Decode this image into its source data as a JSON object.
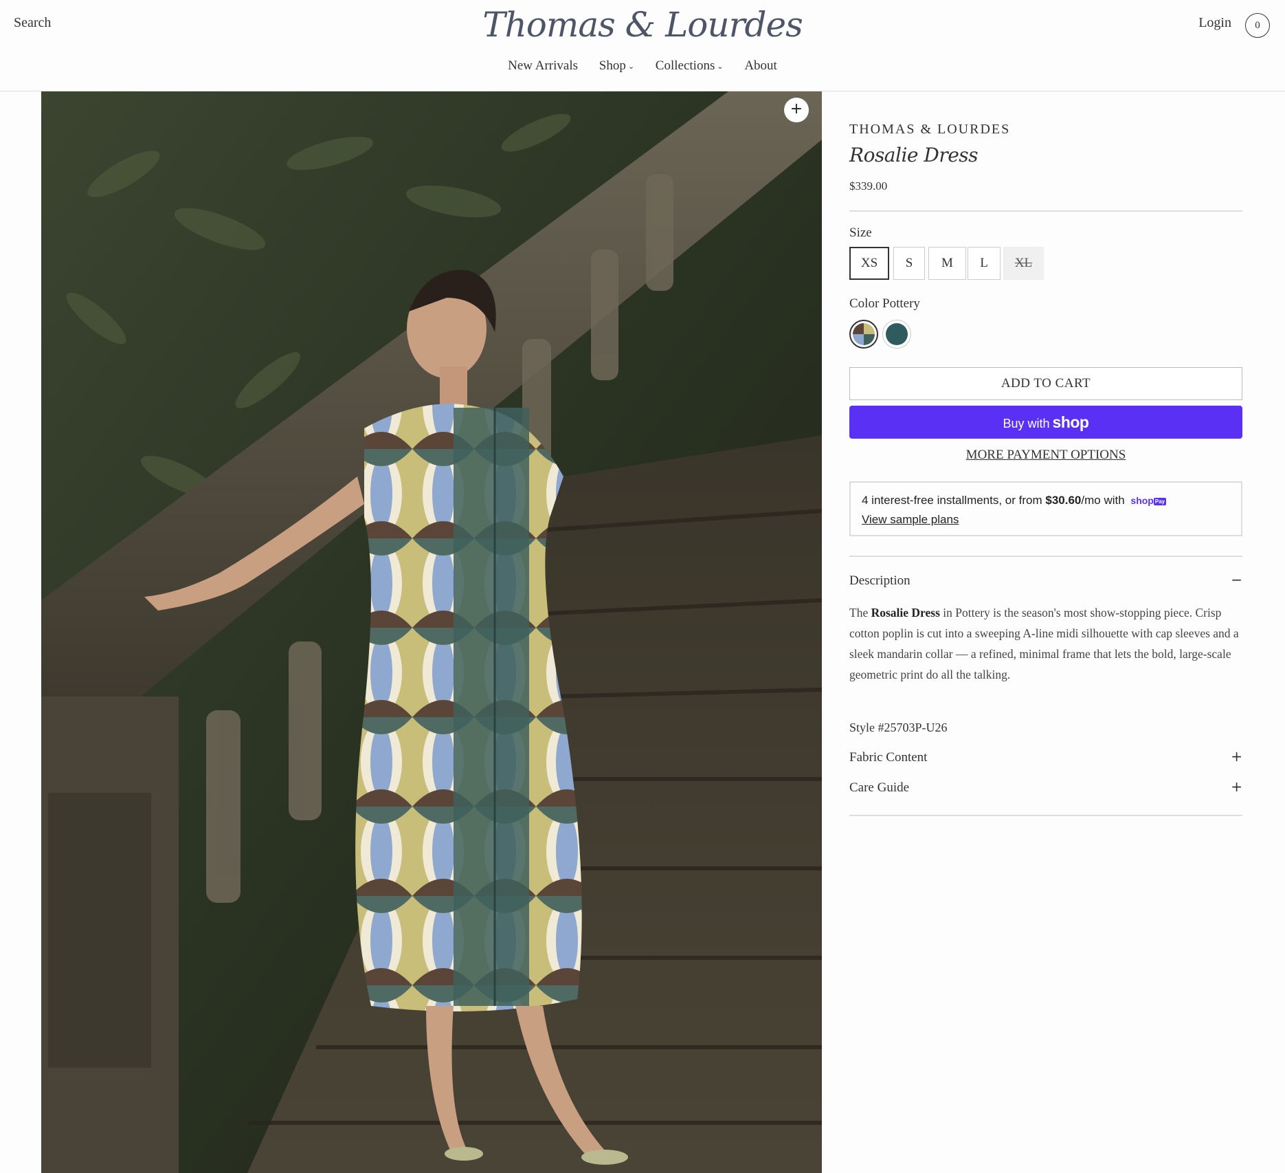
{
  "header": {
    "search_label": "Search",
    "logo_text": "Thomas & Lourdes",
    "login_label": "Login",
    "cart_count": "0",
    "nav": [
      {
        "label": "New Arrivals",
        "has_dropdown": false
      },
      {
        "label": "Shop",
        "has_dropdown": true
      },
      {
        "label": "Collections",
        "has_dropdown": true
      },
      {
        "label": "About",
        "has_dropdown": false
      }
    ]
  },
  "gallery": {
    "zoom_icon": "plus-icon",
    "zoom_label": "+"
  },
  "product": {
    "brand": "THOMAS & LOURDES",
    "title": "Rosalie Dress",
    "price": "$339.00",
    "size_label": "Size",
    "sizes": [
      {
        "label": "XS",
        "selected": true,
        "available": true
      },
      {
        "label": "S",
        "selected": false,
        "available": true
      },
      {
        "label": "M",
        "selected": false,
        "available": true
      },
      {
        "label": "L",
        "selected": false,
        "available": true
      },
      {
        "label": "XL",
        "selected": false,
        "available": false
      }
    ],
    "color_label": "Color",
    "color_value": "Pottery",
    "colors": [
      {
        "name": "Pottery",
        "selected": true,
        "hex": "#6b7a6a"
      },
      {
        "name": "Teal",
        "selected": false,
        "hex": "#2f5b5e"
      }
    ],
    "add_to_cart": "ADD TO CART",
    "buy_with": "Buy with",
    "shop_word": "shop",
    "more_payment": "MORE PAYMENT OPTIONS",
    "installments_text": "4 interest-free installments, or from",
    "installments_amount": "$30.60",
    "installments_suffix": "/mo with",
    "shoppay_text": "shop",
    "shoppay_badge": "Pay",
    "view_sample_plans": "View sample plans",
    "description_title": "Description",
    "description_sign": "−",
    "description_prefix": "The",
    "description_bold": "Rosalie Dress",
    "description_body": "in Pottery is the season's most show-stopping piece. Crisp cotton poplin is cut into a sweeping A-line midi silhouette with cap sleeves and a sleek mandarin collar — a refined, minimal frame that lets the bold, large-scale geometric print do all the talking.",
    "style_number": "Style #25703P-U26",
    "fabric_title": "Fabric Content",
    "care_title": "Care Guide",
    "expand_sign": "+"
  },
  "colors": {
    "shop_pay_purple": "#5a31f4",
    "text": "#333333"
  }
}
